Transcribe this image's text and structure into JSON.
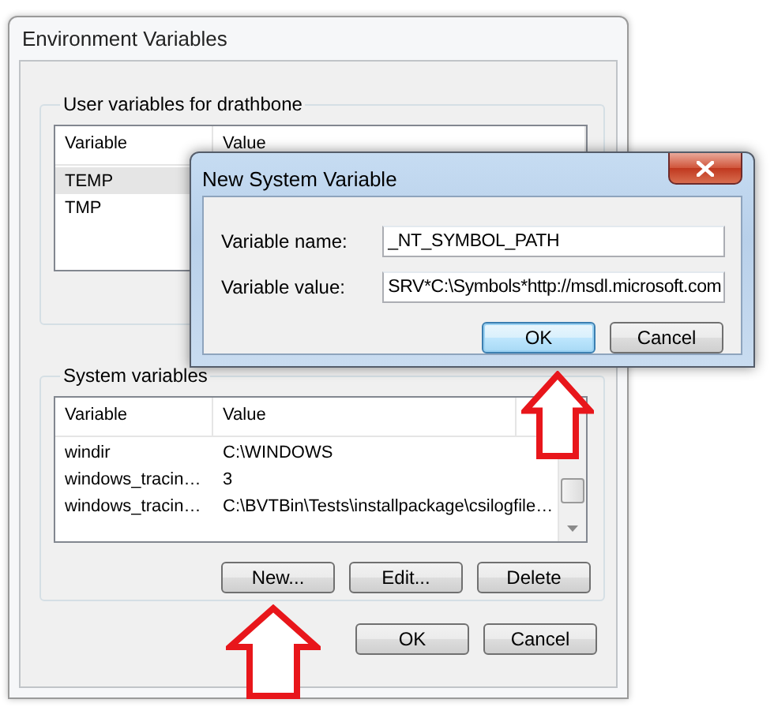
{
  "main_window": {
    "title": "Environment Variables",
    "user_variables": {
      "label": "User variables for drathbone",
      "columns": [
        "Variable",
        "Value"
      ],
      "rows": [
        {
          "variable": "TEMP",
          "selected": true
        },
        {
          "variable": "TMP",
          "selected": false
        }
      ]
    },
    "system_variables": {
      "label": "System variables",
      "columns": [
        "Variable",
        "Value"
      ],
      "rows": [
        {
          "variable": "windir",
          "value": "C:\\WINDOWS",
          "selected": false
        },
        {
          "variable": "windows_tracin…",
          "value": "3",
          "selected": false
        },
        {
          "variable": "windows_tracin…",
          "value": "C:\\BVTBin\\Tests\\installpackage\\csilogfile…",
          "selected": false
        }
      ],
      "buttons": [
        "New...",
        "Edit...",
        "Delete"
      ]
    },
    "buttons": [
      {
        "label": "OK",
        "default": false
      },
      {
        "label": "Cancel",
        "default": false
      }
    ]
  },
  "dialog": {
    "title": "New System Variable",
    "active": true,
    "fields": [
      {
        "label": "Variable name:",
        "value": "_NT_SYMBOL_PATH"
      },
      {
        "label": "Variable value:",
        "value": "SRV*C:\\Symbols*http://msdl.microsoft.com"
      }
    ],
    "buttons": [
      {
        "label": "OK",
        "default": true
      },
      {
        "label": "Cancel",
        "default": false
      }
    ]
  }
}
